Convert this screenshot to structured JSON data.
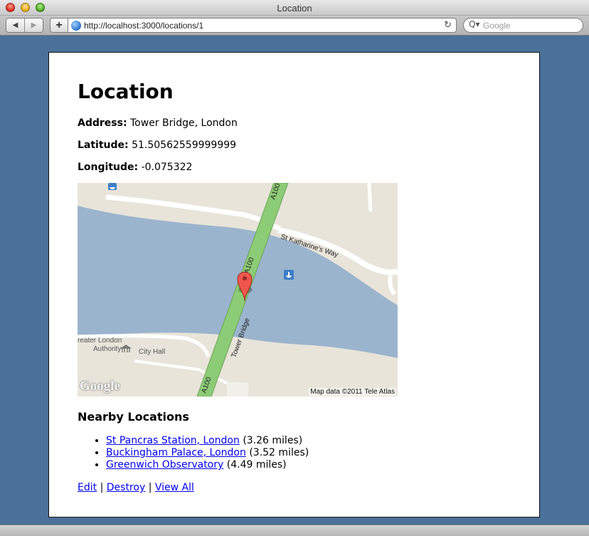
{
  "window": {
    "title": "Location"
  },
  "toolbar": {
    "url": "http://localhost:3000/locations/1",
    "search_placeholder": "Google",
    "add_label": "+",
    "back_glyph": "◀",
    "forward_glyph": "▶",
    "reload_glyph": "↻",
    "search_glyph": "Q▾"
  },
  "page": {
    "title": "Location",
    "address_label": "Address:",
    "address_value": "Tower Bridge, London",
    "latitude_label": "Latitude:",
    "latitude_value": "51.50562559999999",
    "longitude_label": "Longitude:",
    "longitude_value": "-0.075322"
  },
  "map": {
    "road_labels": [
      "A100",
      "A100",
      "Tower Bridge",
      "A100",
      "St Katharine's Way"
    ],
    "place_labels": [
      "reater London",
      "Authority",
      "City Hall"
    ],
    "attribution": "Map data ©2011 Tele Atlas",
    "logo": "Google",
    "colors": {
      "water": "#9bb4cd",
      "land": "#e8e4da",
      "road": "#8dcc76",
      "marker": "#f0564d"
    }
  },
  "nearby": {
    "title": "Nearby Locations",
    "items": [
      {
        "name": "St Pancras Station, London",
        "distance": "(3.26 miles)"
      },
      {
        "name": "Buckingham Palace, London",
        "distance": "(3.52 miles)"
      },
      {
        "name": "Greenwich Observatory",
        "distance": "(4.49 miles)"
      }
    ]
  },
  "actions": {
    "edit": "Edit",
    "destroy": "Destroy",
    "view_all": "View All",
    "separator": "|"
  }
}
